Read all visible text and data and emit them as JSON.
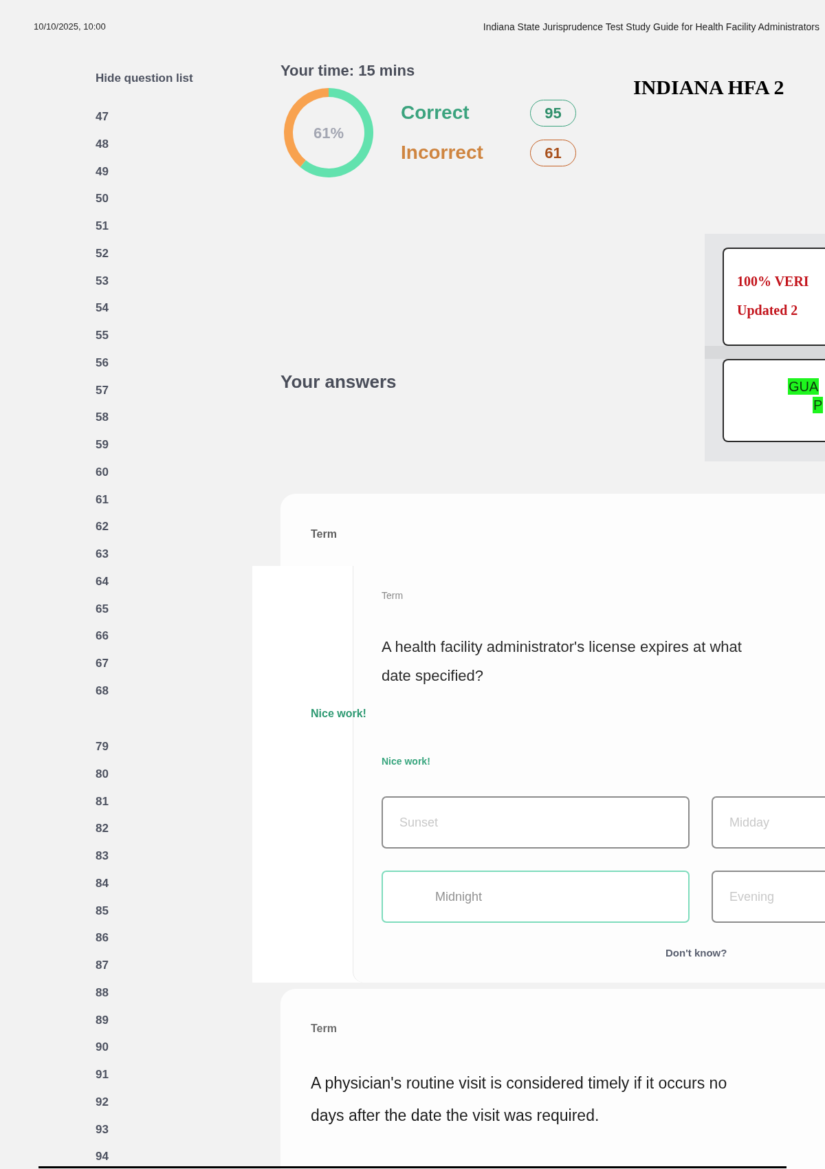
{
  "header": {
    "date": "10/10/2025, 10:00",
    "title": "Indiana State Jurisprudence Test Study Guide for Health Facility Administrators"
  },
  "question_list": {
    "toggle": "Hide question list",
    "groups": [
      {
        "numbers": [
          "47",
          "48",
          "49",
          "50",
          "51",
          "52",
          "53",
          "54",
          "55",
          "56",
          "57",
          "58",
          "59",
          "60",
          "61",
          "62",
          "63",
          "64",
          "65",
          "66",
          "67",
          "68"
        ]
      },
      {
        "numbers": [
          "79",
          "80",
          "81",
          "82",
          "83",
          "84",
          "85",
          "86",
          "87",
          "88",
          "89",
          "90",
          "91",
          "92",
          "93",
          "94"
        ]
      }
    ]
  },
  "score": {
    "time": "Your time: 15 mins",
    "chart_data": {
      "type": "donut",
      "values": [
        61,
        39
      ]
    },
    "percent": "61%",
    "results": [
      {
        "kind": "correct",
        "label": "Correct",
        "count": "95"
      },
      {
        "kind": "incorrect",
        "label": "Incorrect",
        "count": "61"
      }
    ]
  },
  "banner": {
    "title": "INDIANA HFA 2",
    "cards": [
      {
        "kind": "verified",
        "lines": [
          "100% VERI",
          "Updated 2"
        ]
      },
      {
        "kind": "guarantee",
        "lines": [
          "GUA",
          "P"
        ]
      }
    ]
  },
  "answers": {
    "heading": "Your answers",
    "card_behind": {
      "term_label": "Term",
      "feedback": "Nice work!"
    },
    "card_front": {
      "term_label": "Term",
      "question_lines": [
        "A health facility administrator's license expires at what",
        "date specified?"
      ],
      "feedback": "Nice work!",
      "options": [
        {
          "label": "Sunset",
          "selected": false
        },
        {
          "label": "Midday",
          "selected": false
        },
        {
          "label": "Midnight",
          "selected": true
        },
        {
          "label": "Evening",
          "selected": false
        }
      ],
      "dont_know": "Don't know?"
    },
    "card_next": {
      "term_label": "Term",
      "question_lines": [
        "A physician's routine visit is considered timely if it occurs no",
        "days after the date the visit was required."
      ]
    }
  }
}
